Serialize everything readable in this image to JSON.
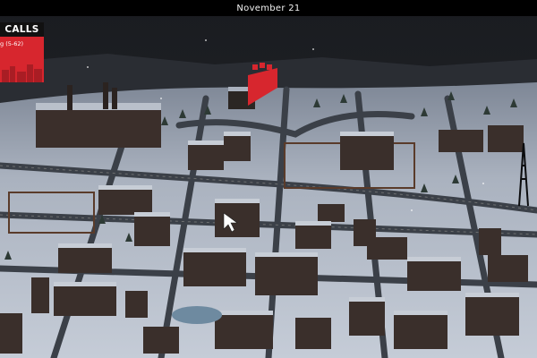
{
  "top_bar": {
    "date": "November 21"
  },
  "calls_panel": {
    "title": "CALLS",
    "entries": [
      {
        "text": "g (5-62)"
      }
    ]
  },
  "map": {
    "description_icon": "city-map",
    "marker_icon": "fire-station-marker-icon",
    "cursor_icon": "pointer-cursor-icon"
  },
  "colors": {
    "top_bar": "#000000",
    "calls_accent": "#d7262e",
    "snow": "#c9d1dd",
    "road": "#3b4048",
    "building": "#3a2f2b"
  }
}
